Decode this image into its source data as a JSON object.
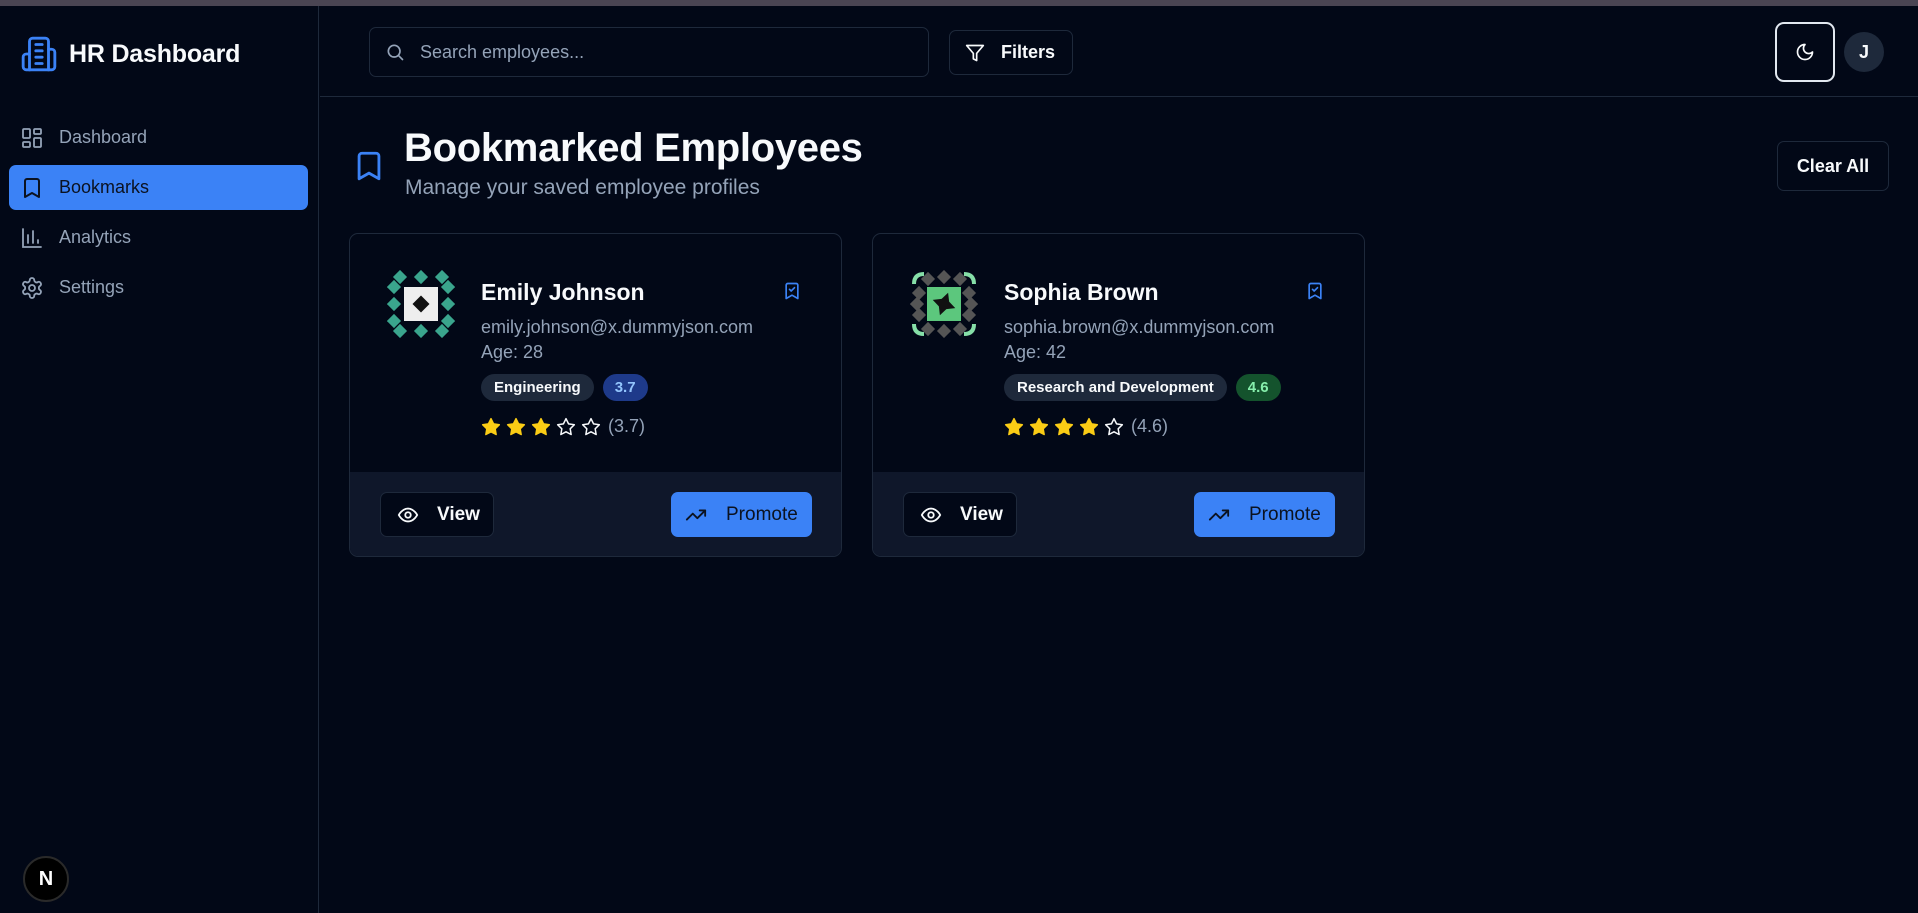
{
  "app": {
    "title": "HR Dashboard"
  },
  "sidebar": {
    "items": [
      {
        "label": "Dashboard",
        "icon": "grid-icon",
        "active": false
      },
      {
        "label": "Bookmarks",
        "icon": "bookmark-icon",
        "active": true
      },
      {
        "label": "Analytics",
        "icon": "bar-chart-icon",
        "active": false
      },
      {
        "label": "Settings",
        "icon": "gear-icon",
        "active": false
      }
    ],
    "footer_badge": "N"
  },
  "header": {
    "search": {
      "placeholder": "Search employees...",
      "value": ""
    },
    "filters_label": "Filters",
    "user_initial": "J"
  },
  "page": {
    "title": "Bookmarked Employees",
    "subtitle": "Manage your saved employee profiles",
    "clear_label": "Clear All"
  },
  "employees": [
    {
      "name": "Emily Johnson",
      "email": "emily.johnson@x.dummyjson.com",
      "age": "Age: 28",
      "department": "Engineering",
      "score": "3.7",
      "rating": 3,
      "rating_text": "(3.7)",
      "score_bg": "#1e3a8a",
      "score_color": "#93c5fd",
      "view_label": "View",
      "promote_label": "Promote"
    },
    {
      "name": "Sophia Brown",
      "email": "sophia.brown@x.dummyjson.com",
      "age": "Age: 42",
      "department": "Research and Development",
      "score": "4.6",
      "rating": 4,
      "rating_text": "(4.6)",
      "score_bg": "#14532d",
      "score_color": "#86efac",
      "view_label": "View",
      "promote_label": "Promote"
    }
  ],
  "colors": {
    "accent": "#3b82f6",
    "star": "#facc15",
    "background": "#020817"
  }
}
